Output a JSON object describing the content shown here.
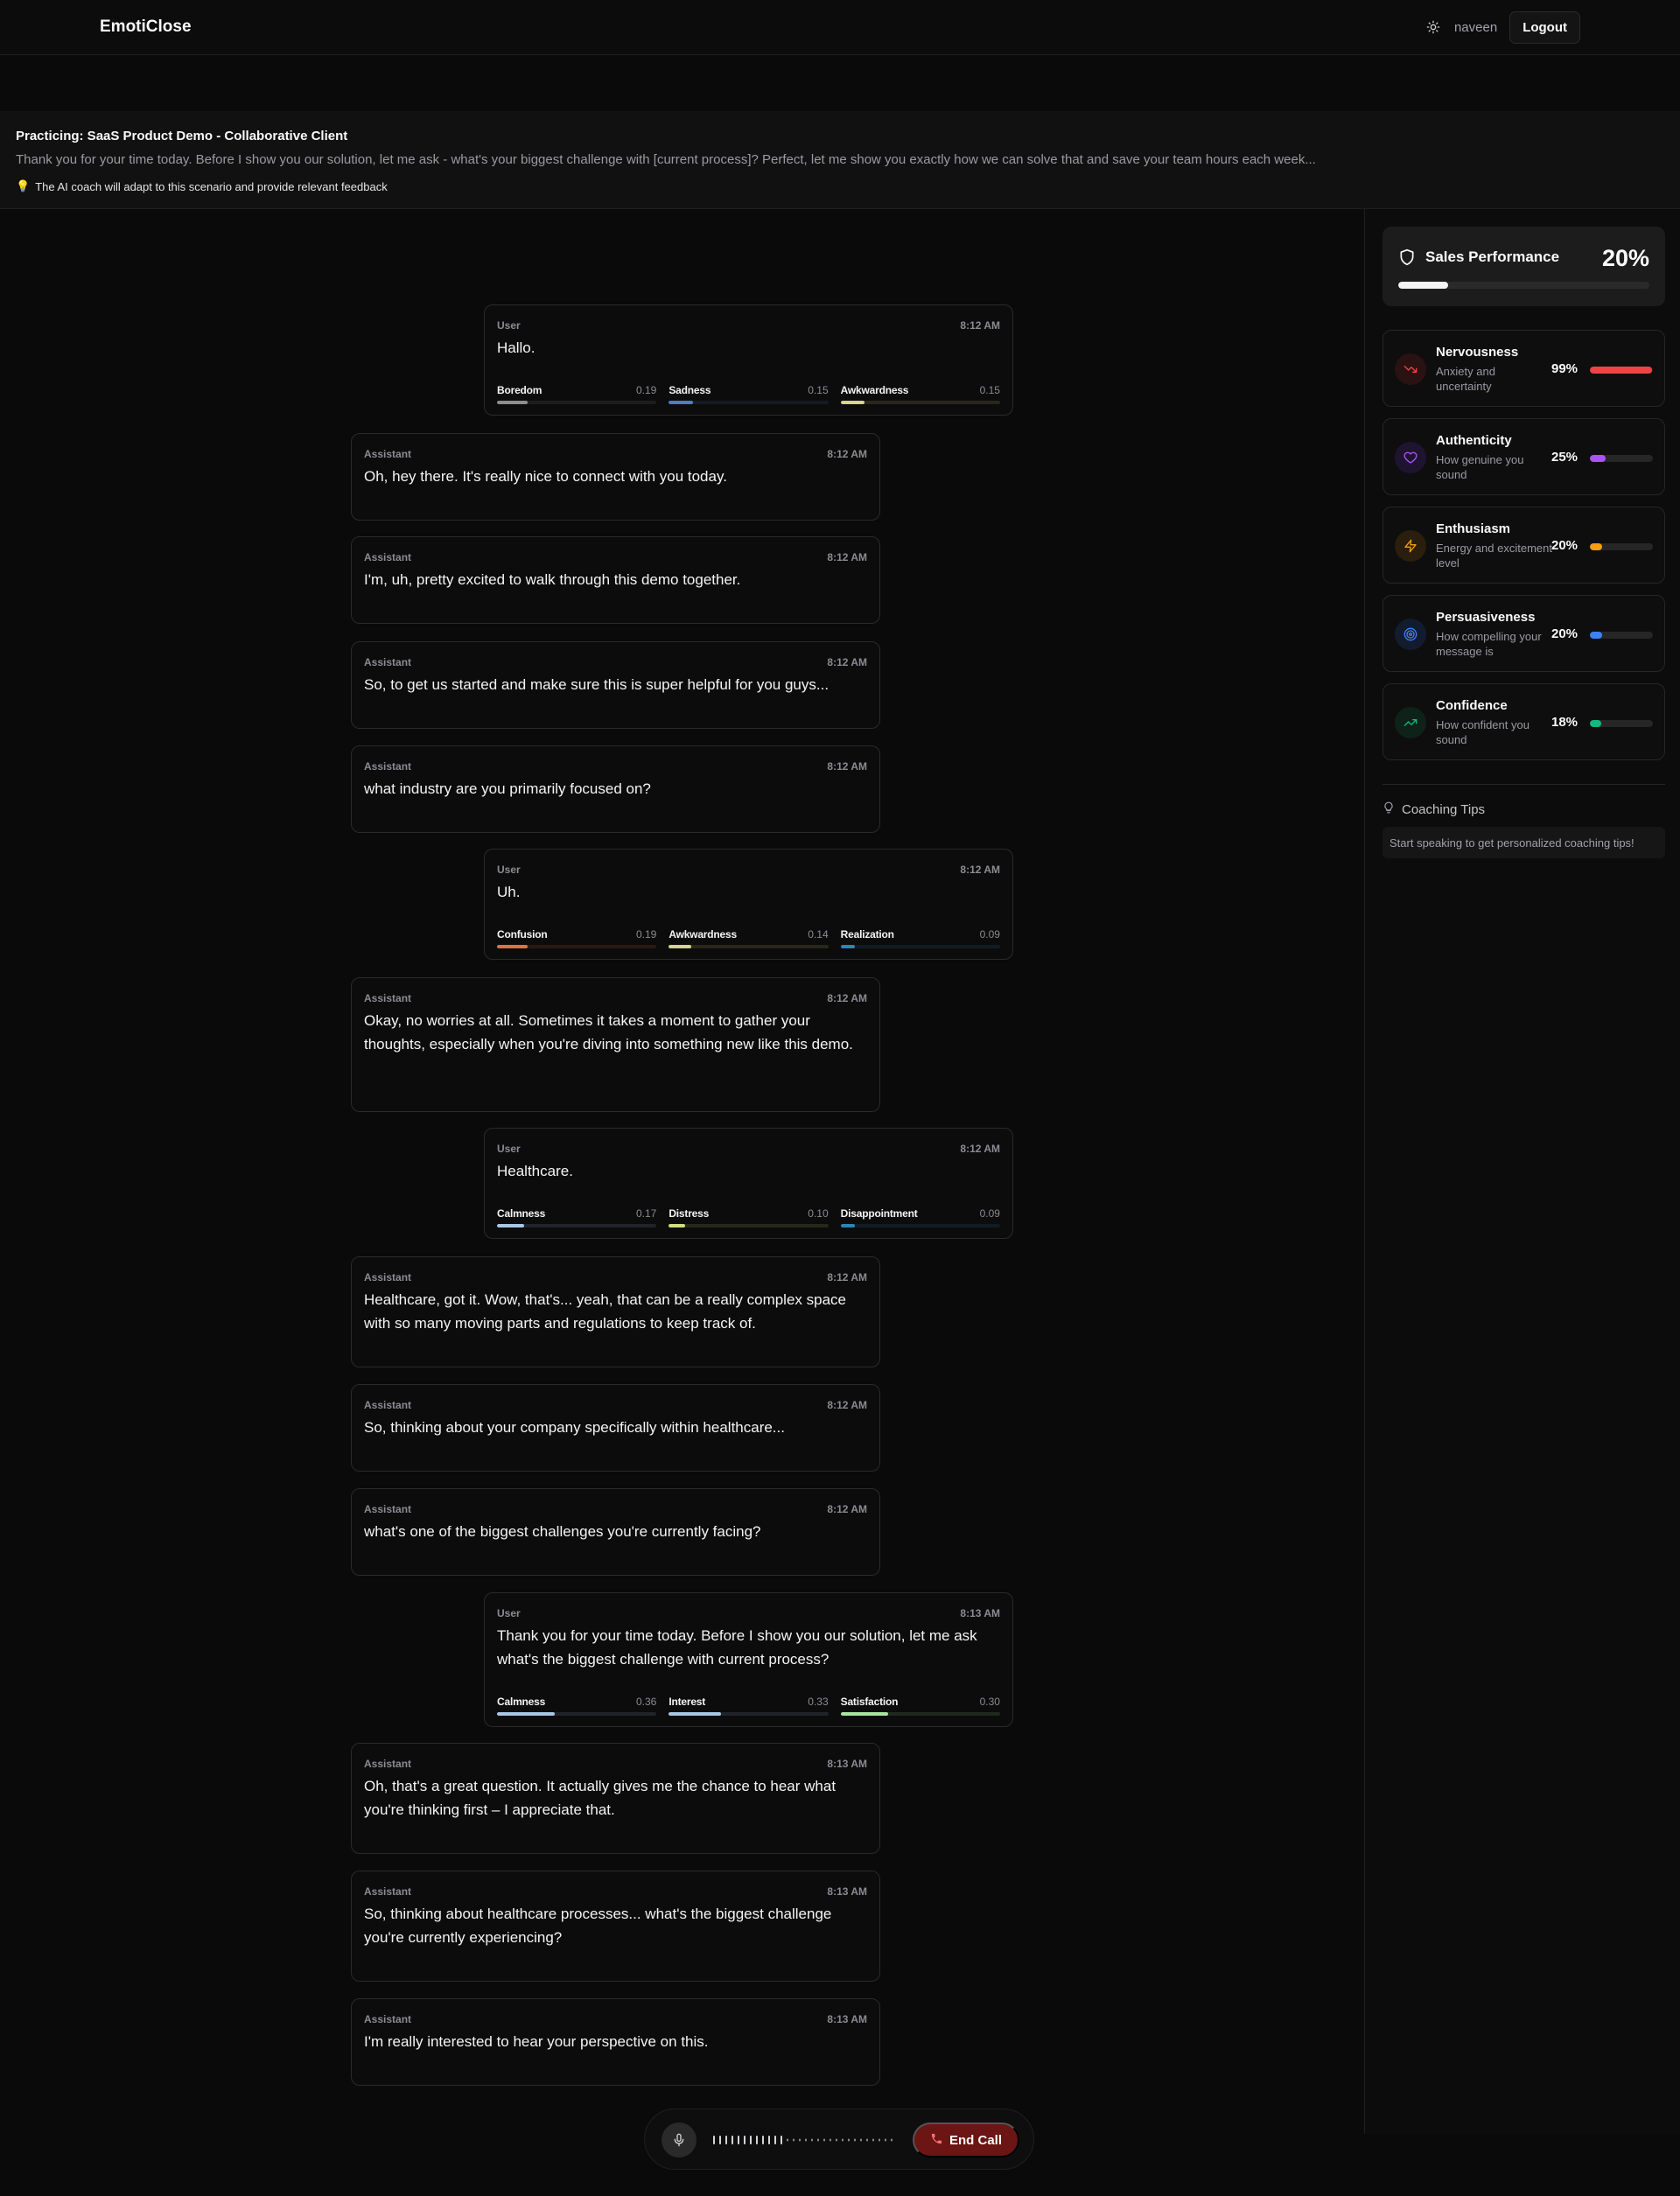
{
  "header": {
    "brand": "EmotiClose",
    "username": "naveen",
    "logout_label": "Logout"
  },
  "scenario": {
    "title": "Practicing: SaaS Product Demo - Collaborative Client",
    "description": "Thank you for your time today. Before I show you our solution, let me ask - what's your biggest challenge with [current process]? Perfect, let me show you exactly how we can solve that and save your team hours each week...",
    "tip": "The AI coach will adapt to this scenario and provide relevant feedback"
  },
  "messages": [
    {
      "role": "User",
      "time": "8:12 AM",
      "text": "Hallo.",
      "emotions": [
        {
          "name": "Boredom",
          "score": "0.19",
          "value": 0.19,
          "color": "#8e8e8e"
        },
        {
          "name": "Sadness",
          "score": "0.15",
          "value": 0.15,
          "color": "#4f7cc2"
        },
        {
          "name": "Awkwardness",
          "score": "0.15",
          "value": 0.15,
          "color": "#d6d68a"
        }
      ]
    },
    {
      "role": "Assistant",
      "time": "8:12 AM",
      "text": "Oh, hey there. It's really nice to connect with you today."
    },
    {
      "role": "Assistant",
      "time": "8:12 AM",
      "text": "I'm, uh, pretty excited to walk through this demo together."
    },
    {
      "role": "Assistant",
      "time": "8:12 AM",
      "text": "So, to get us started and make sure this is super helpful for you guys..."
    },
    {
      "role": "Assistant",
      "time": "8:12 AM",
      "text": "what industry are you primarily focused on?"
    },
    {
      "role": "User",
      "time": "8:12 AM",
      "text": "Uh.",
      "emotions": [
        {
          "name": "Confusion",
          "score": "0.19",
          "value": 0.19,
          "color": "#e0733a"
        },
        {
          "name": "Awkwardness",
          "score": "0.14",
          "value": 0.14,
          "color": "#d6d68a"
        },
        {
          "name": "Realization",
          "score": "0.09",
          "value": 0.09,
          "color": "#2a86b8"
        }
      ]
    },
    {
      "role": "Assistant",
      "time": "8:12 AM",
      "text": "Okay, no worries at all. Sometimes it takes a moment to gather your thoughts, especially when you're diving into something new like this demo."
    },
    {
      "role": "User",
      "time": "8:12 AM",
      "text": "Healthcare.",
      "emotions": [
        {
          "name": "Calmness",
          "score": "0.17",
          "value": 0.17,
          "color": "#a8c6e6"
        },
        {
          "name": "Distress",
          "score": "0.10",
          "value": 0.1,
          "color": "#cde07a"
        },
        {
          "name": "Disappointment",
          "score": "0.09",
          "value": 0.09,
          "color": "#2a86b8"
        }
      ]
    },
    {
      "role": "Assistant",
      "time": "8:12 AM",
      "text": "Healthcare, got it. Wow, that's... yeah, that can be a really complex space with so many moving parts and regulations to keep track of."
    },
    {
      "role": "Assistant",
      "time": "8:12 AM",
      "text": "So, thinking about your company specifically within healthcare..."
    },
    {
      "role": "Assistant",
      "time": "8:12 AM",
      "text": "what's one of the biggest challenges you're currently facing?"
    },
    {
      "role": "User",
      "time": "8:13 AM",
      "text": "Thank you for your time today. Before I show you our solution, let me ask what's the biggest challenge with current process?",
      "emotions": [
        {
          "name": "Calmness",
          "score": "0.36",
          "value": 0.36,
          "color": "#a8c6e6"
        },
        {
          "name": "Interest",
          "score": "0.33",
          "value": 0.33,
          "color": "#a8c6e6"
        },
        {
          "name": "Satisfaction",
          "score": "0.30",
          "value": 0.3,
          "color": "#a8e6a0"
        }
      ]
    },
    {
      "role": "Assistant",
      "time": "8:13 AM",
      "text": "Oh, that's a great question. It actually gives me the chance to hear what you're thinking first – I appreciate that."
    },
    {
      "role": "Assistant",
      "time": "8:13 AM",
      "text": "So, thinking about healthcare processes... what's the biggest challenge you're currently experiencing?"
    },
    {
      "role": "Assistant",
      "time": "8:13 AM",
      "text": "I'm really interested to hear your perspective on this."
    }
  ],
  "performance": {
    "title": "Sales Performance",
    "value_label": "20%",
    "value": 0.2
  },
  "metrics": [
    {
      "name": "Nervousness",
      "desc": "Anxiety and uncertainty",
      "value_label": "99%",
      "value": 0.99,
      "color": "#ef4444",
      "icon": "trending-down-icon",
      "icon_bg": "#2a1212"
    },
    {
      "name": "Authenticity",
      "desc": "How genuine you sound",
      "value_label": "25%",
      "value": 0.25,
      "color": "#a855f7",
      "icon": "heart-icon",
      "icon_bg": "#1e1430"
    },
    {
      "name": "Enthusiasm",
      "desc": "Energy and excitement level",
      "value_label": "20%",
      "value": 0.2,
      "color": "#f59e0b",
      "icon": "zap-icon",
      "icon_bg": "#2a1e0c"
    },
    {
      "name": "Persuasiveness",
      "desc": "How compelling your message is",
      "value_label": "20%",
      "value": 0.2,
      "color": "#3b82f6",
      "icon": "target-icon",
      "icon_bg": "#121c2e"
    },
    {
      "name": "Confidence",
      "desc": "How confident you sound",
      "value_label": "18%",
      "value": 0.18,
      "color": "#10b981",
      "icon": "trending-up-icon",
      "icon_bg": "#0e2219"
    }
  ],
  "coaching": {
    "title": "Coaching Tips",
    "empty_text": "Start speaking to get personalized coaching tips!"
  },
  "callbar": {
    "end_call_label": "End Call"
  }
}
